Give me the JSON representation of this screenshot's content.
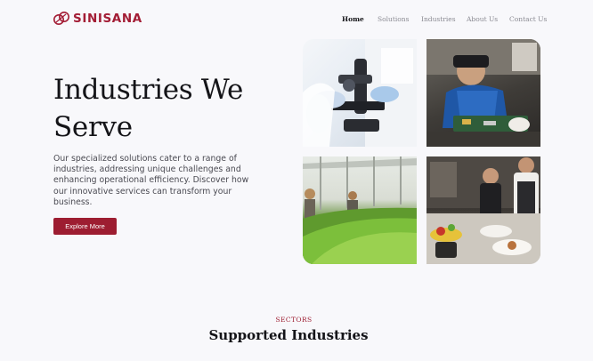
{
  "brand": {
    "name": "SINISANA",
    "logo_icon": "linked-rings-icon",
    "color": "#a31d35"
  },
  "nav": {
    "items": [
      {
        "label": "Home",
        "active": true
      },
      {
        "label": "Solutions",
        "active": false
      },
      {
        "label": "Industries",
        "active": false
      },
      {
        "label": "About Us",
        "active": false
      },
      {
        "label": "Contact Us",
        "active": false
      }
    ]
  },
  "hero": {
    "title": "Industries We Serve",
    "description": "Our specialized solutions cater to a range of industries, addressing unique challenges and enhancing operational efficiency. Discover how our innovative services can transform your business.",
    "cta_label": "Explore More",
    "accent": "#9d1d31",
    "images": [
      "laboratory-microscope",
      "electronics-soldering",
      "greenhouse-lettuce",
      "restaurant-kitchen"
    ]
  },
  "sectors": {
    "eyebrow": "SECTORS",
    "title": "Supported Industries"
  }
}
